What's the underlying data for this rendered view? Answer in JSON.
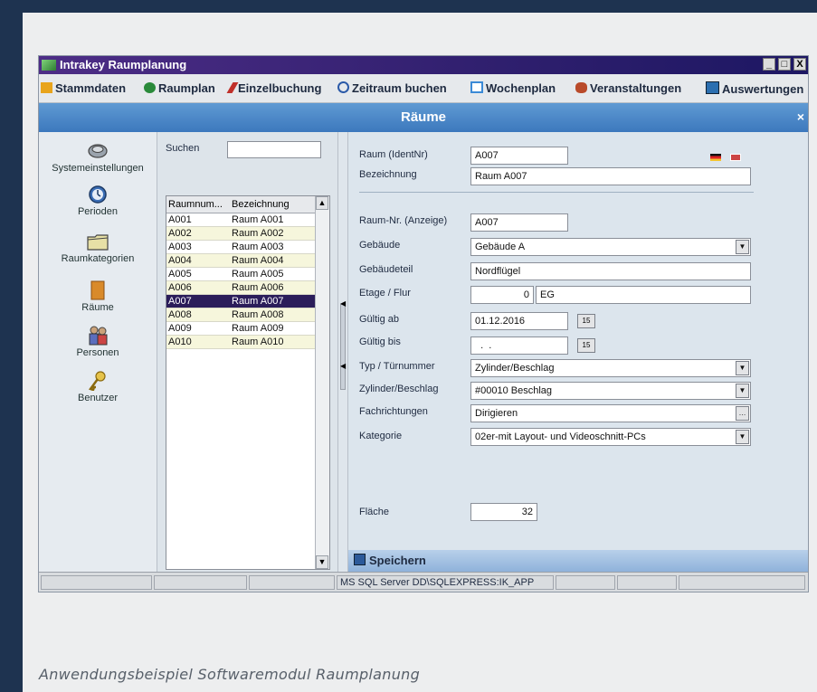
{
  "window": {
    "title": "Intrakey Raumplanung",
    "minimize": "_",
    "maximize": "□",
    "close": "X"
  },
  "menu": [
    {
      "label": "Stammdaten",
      "icon": "stammdaten-icon",
      "color": "#e8a41c"
    },
    {
      "label": "Raumplan",
      "icon": "raumplan-icon",
      "color": "#2a8a3a"
    },
    {
      "label": "Einzelbuchung",
      "icon": "pen-icon",
      "color": "#c0302a"
    },
    {
      "label": "Zeitraum buchen",
      "icon": "clock-icon",
      "color": "#2b5aa8"
    },
    {
      "label": "Wochenplan",
      "icon": "calendar-icon",
      "color": "#3b8ad6"
    },
    {
      "label": "Veranstaltungen",
      "icon": "people-icon",
      "color": "#b94a2a"
    },
    {
      "label": "Auswertungen",
      "icon": "chart-icon",
      "color": "#2b6fb0"
    }
  ],
  "header": {
    "title": "Räume",
    "close": "×"
  },
  "nav": [
    {
      "label": "Systemeinstellungen",
      "icon": "settings-icon"
    },
    {
      "label": "Perioden",
      "icon": "periods-clock-icon"
    },
    {
      "label": "Raumkategorien",
      "icon": "folder-icon"
    },
    {
      "label": "Räume",
      "icon": "door-icon"
    },
    {
      "label": "Personen",
      "icon": "persons-icon"
    },
    {
      "label": "Benutzer",
      "icon": "key-icon"
    }
  ],
  "list": {
    "search_label": "Suchen",
    "search_value": "",
    "columns": [
      "Raumnum...",
      "Bezeichnung"
    ],
    "rows": [
      [
        "A001",
        "Raum A001"
      ],
      [
        "A002",
        "Raum A002"
      ],
      [
        "A003",
        "Raum A003"
      ],
      [
        "A004",
        "Raum A004"
      ],
      [
        "A005",
        "Raum A005"
      ],
      [
        "A006",
        "Raum A006"
      ],
      [
        "A007",
        "Raum A007"
      ],
      [
        "A008",
        "Raum A008"
      ],
      [
        "A009",
        "Raum A009"
      ],
      [
        "A010",
        "Raum A010"
      ]
    ],
    "selected": "A007"
  },
  "form": {
    "raum_ident": {
      "label": "Raum (IdentNr)",
      "value": "A007"
    },
    "bezeichnung": {
      "label": "Bezeichnung",
      "value": "Raum A007"
    },
    "raum_nr": {
      "label": "Raum-Nr. (Anzeige)",
      "value": "A007"
    },
    "gebaeude": {
      "label": "Gebäude",
      "value": "Gebäude A"
    },
    "gebaeudeteil": {
      "label": "Gebäudeteil",
      "value": "Nordflügel"
    },
    "etage": {
      "label": "Etage / Flur",
      "value_num": "0",
      "value_text": "EG"
    },
    "gueltig_ab": {
      "label": "Gültig ab",
      "value": "01.12.2016"
    },
    "gueltig_bis": {
      "label": "Gültig bis",
      "value": "  .  ."
    },
    "typ": {
      "label": "Typ / Türnummer",
      "value": "Zylinder/Beschlag"
    },
    "zylinder": {
      "label": "Zylinder/Beschlag",
      "value": "#00010 Beschlag"
    },
    "fachrichtungen": {
      "label": "Fachrichtungen",
      "value": "Dirigieren"
    },
    "kategorie": {
      "label": "Kategorie",
      "value": "02er-mit Layout- und Videoschnitt-PCs"
    },
    "flaeche": {
      "label": "Fläche",
      "value": "32"
    }
  },
  "save": {
    "label": "Speichern"
  },
  "status": {
    "connection": "MS SQL Server DD\\SQLEXPRESS:IK_APP"
  },
  "caption": "Anwendungsbeispiel Softwaremodul Raumplanung",
  "colors": {
    "accent": "#3c78bd",
    "selection": "#2b1d5a",
    "row_alt": "#f6f6dc",
    "title": "#3a2272"
  }
}
